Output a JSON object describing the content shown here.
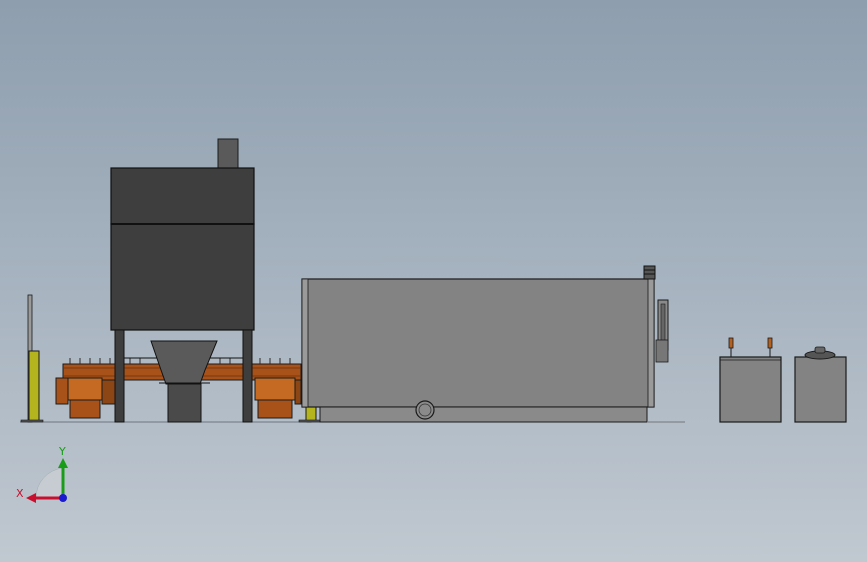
{
  "viewport": {
    "background_top": "#8e9eae",
    "background_bottom": "#c0c8d0"
  },
  "triad": {
    "x_label": "X",
    "y_label": "Y",
    "x_color": "#c8102e",
    "y_color": "#1a9b1a",
    "z_color": "#1a1ad0"
  },
  "colors": {
    "dark_body": "#3e3e3e",
    "tank_body": "#838383",
    "trough": "#a8521a",
    "trough_light": "#c46a22",
    "post_yellow": "#b4b41e",
    "outline": "#1a1a1a"
  }
}
